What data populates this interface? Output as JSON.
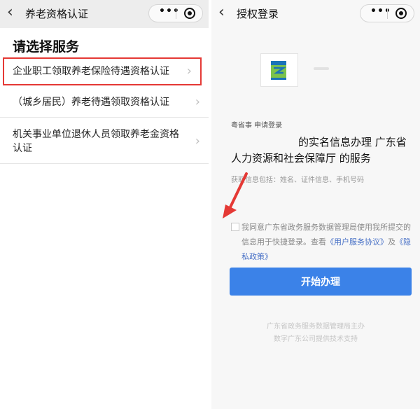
{
  "left": {
    "nav": {
      "back_label": "‹",
      "title": "养老资格认证",
      "menu_icon": "more-dots-icon",
      "close_icon": "target-close-icon"
    },
    "heading": "请选择服务",
    "services": [
      {
        "label": "企业职工领取养老保险待遇资格认证",
        "highlighted": true
      },
      {
        "label": "（城乡居民）养老待遇领取资格认证",
        "highlighted": false
      },
      {
        "label": "机关事业单位退休人员领取养老金资格认证",
        "highlighted": false
      }
    ],
    "chevron": "›",
    "highlight_color": "#e53935"
  },
  "right": {
    "nav": {
      "back_label": "‹",
      "title": "授权登录",
      "menu_icon": "more-dots-icon",
      "close_icon": "target-close-icon"
    },
    "applicant_line": "粤省事 申请登录",
    "service_desc": "的实名信息办理 广东省人力资源和社会保障厅 的服务",
    "info_line": "获取信息包括：姓名、证件信息、手机号码",
    "agreement": {
      "text_before": "我同意广东省政务服务数据管理局使用我所提交的信息用于快捷登录。查看",
      "link_service": "《用户服务协议》",
      "connector": "及",
      "link_privacy": "《隐私政策》"
    },
    "start_button": "开始办理",
    "footer_line1": "广东省政务服务数据管理局主办",
    "footer_line2": "数字广东公司提供技术支持",
    "primary_color": "#3b82e8",
    "annotation_arrow_color": "#e53935"
  }
}
